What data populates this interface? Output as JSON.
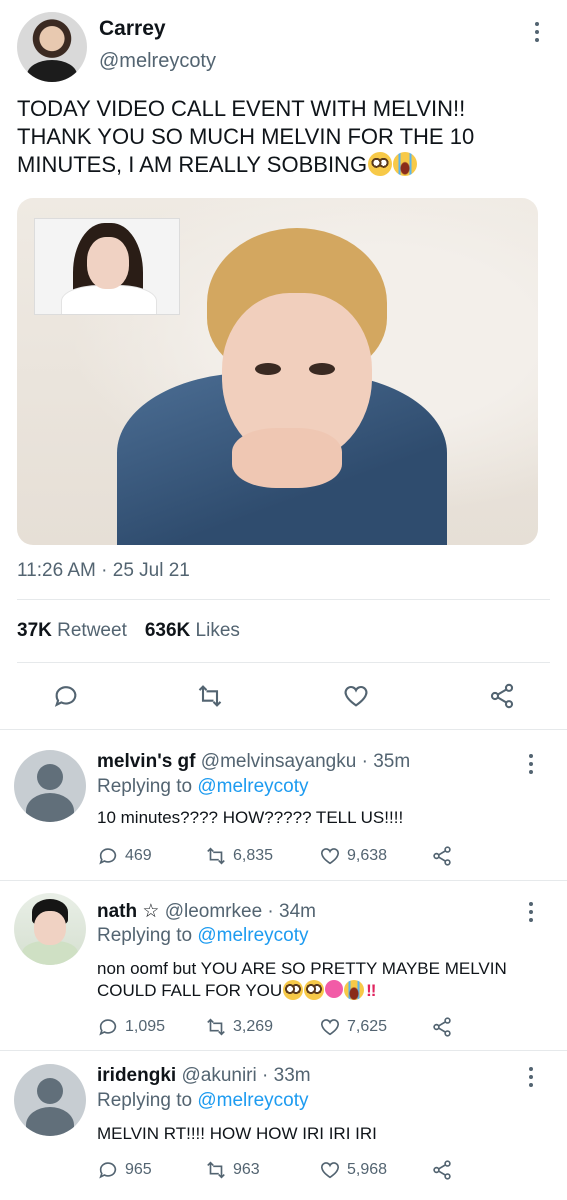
{
  "tweet": {
    "author_name": "Carrey",
    "author_handle": "@melreycoty",
    "text": "TODAY VIDEO CALL EVENT WITH MELVIN!! THANK YOU SO MUCH MELVIN FOR THE 10 MINUTES, I AM REALLY SOBBING",
    "timestamp": "11:26 AM · 25 Jul 21",
    "stats": {
      "retweets_count": "37K",
      "retweets_label": "Retweet",
      "likes_count": "636K",
      "likes_label": "Likes"
    },
    "icons": [
      "reply-icon",
      "retweet-icon",
      "like-icon",
      "share-icon",
      "more-icon"
    ]
  },
  "replies": [
    {
      "name": "melvin's gf",
      "handle": "@melvinsayangku",
      "time": "· 35m",
      "replying_prefix": "Replying to",
      "replying_to": "@melreycoty",
      "text": "10 minutes???? HOW????? TELL US!!!!",
      "reply_count": "469",
      "retweet_count": "6,835",
      "like_count": "9,638"
    },
    {
      "name": "nath ☆",
      "handle": "@leomrkee",
      "time": "· 34m",
      "replying_prefix": "Replying to",
      "replying_to": "@melreycoty",
      "text": "non oomf but YOU ARE SO PRETTY MAYBE MELVIN COULD FALL FOR YOU",
      "reply_count": "1,095",
      "retweet_count": "3,269",
      "like_count": "7,625"
    },
    {
      "name": "iridengki",
      "handle": "@akuniri",
      "time": "· 33m",
      "replying_prefix": "Replying to",
      "replying_to": "@melreycoty",
      "text": "MELVIN RT!!!! HOW HOW IRI IRI IRI",
      "reply_count": "965",
      "retweet_count": "963",
      "like_count": "5,968"
    }
  ],
  "colors": {
    "text": "#0f1419",
    "secondary": "#536471",
    "link": "#1d9bf0",
    "divider": "#e6e9eb"
  }
}
